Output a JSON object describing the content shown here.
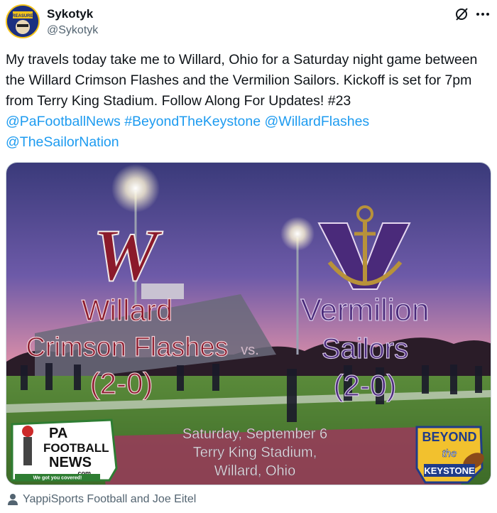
{
  "author": {
    "display_name": "Sykotyk",
    "handle": "@Sykotyk",
    "avatar_text": "TREASURES"
  },
  "tweet": {
    "text_plain": "My travels today take me to Willard, Ohio for a Saturday night game between the Willard Crimson Flashes and the Vermilion Sailors. Kickoff is set for 7pm from Terry King Stadium. Follow Along For Updates! #23",
    "links": [
      "@PaFootballNews",
      "#BeyondTheKeystone",
      "@WillardFlashes",
      "@TheSailorNation"
    ]
  },
  "media": {
    "home_team": {
      "logo_letter": "W",
      "name_line1": "Willard",
      "name_line2": "Crimson Flashes",
      "record": "(2-0)"
    },
    "vs": "vs.",
    "away_team": {
      "name_line1": "Vermilion",
      "name_line2": "Sailors",
      "record": "(2-0)"
    },
    "game_info": {
      "line1": "Saturday, September 6",
      "line2": "Terry King Stadium,",
      "line3": "Willard, Ohio"
    },
    "left_logo": {
      "line1": "PA",
      "line2": "FOOTBALL",
      "line3": "NEWS",
      "domain": ".com",
      "tagline": "We got you covered!"
    },
    "right_logo": {
      "line1": "BEYOND",
      "line2": "the",
      "line3": "KEYSTONE"
    }
  },
  "footer": {
    "tagged_people": "YappiSports Football and Joe Eitel"
  },
  "colors": {
    "link": "#1d9bf0",
    "text_secondary": "#536471",
    "willard_crimson": "#8b1a2b",
    "vermilion_purple": "#4a2a7a",
    "vermilion_gold": "#b8923a"
  }
}
